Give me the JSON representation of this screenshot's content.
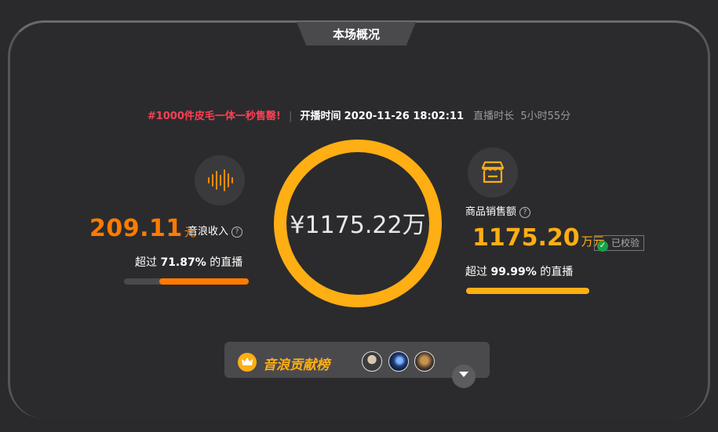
{
  "header": {
    "title": "本场概况"
  },
  "info": {
    "tag": "#1000件皮毛一体一秒售罄!",
    "separator": "|",
    "start_label": "开播时间",
    "start_time": "2020-11-26 18:02:11",
    "duration_label": "直播时长",
    "duration": "5小时55分"
  },
  "center": {
    "total": "¥1175.22万"
  },
  "left": {
    "value": "209.11",
    "unit": "元",
    "label": "音浪收入",
    "exceed_prefix": "超过",
    "exceed_percent": "71.87%",
    "exceed_suffix": "的直播",
    "bar_fraction": 0.7187
  },
  "right": {
    "label": "商品销售额",
    "value": "1175.20",
    "unit": "万元",
    "verified_label": "已校验",
    "exceed_prefix": "超过",
    "exceed_percent": "99.99%",
    "exceed_suffix": "的直播",
    "bar_fraction": 0.9999
  },
  "leaderboard": {
    "title": "音浪贡献榜"
  },
  "colors": {
    "accent_orange": "#ff7b00",
    "accent_gold": "#ffae14",
    "tag_red": "#ff3f55"
  },
  "icons": [
    "sound-wave-icon",
    "shop-icon",
    "question-icon",
    "verified-shield-icon",
    "crown-icon",
    "chevron-down-icon"
  ]
}
